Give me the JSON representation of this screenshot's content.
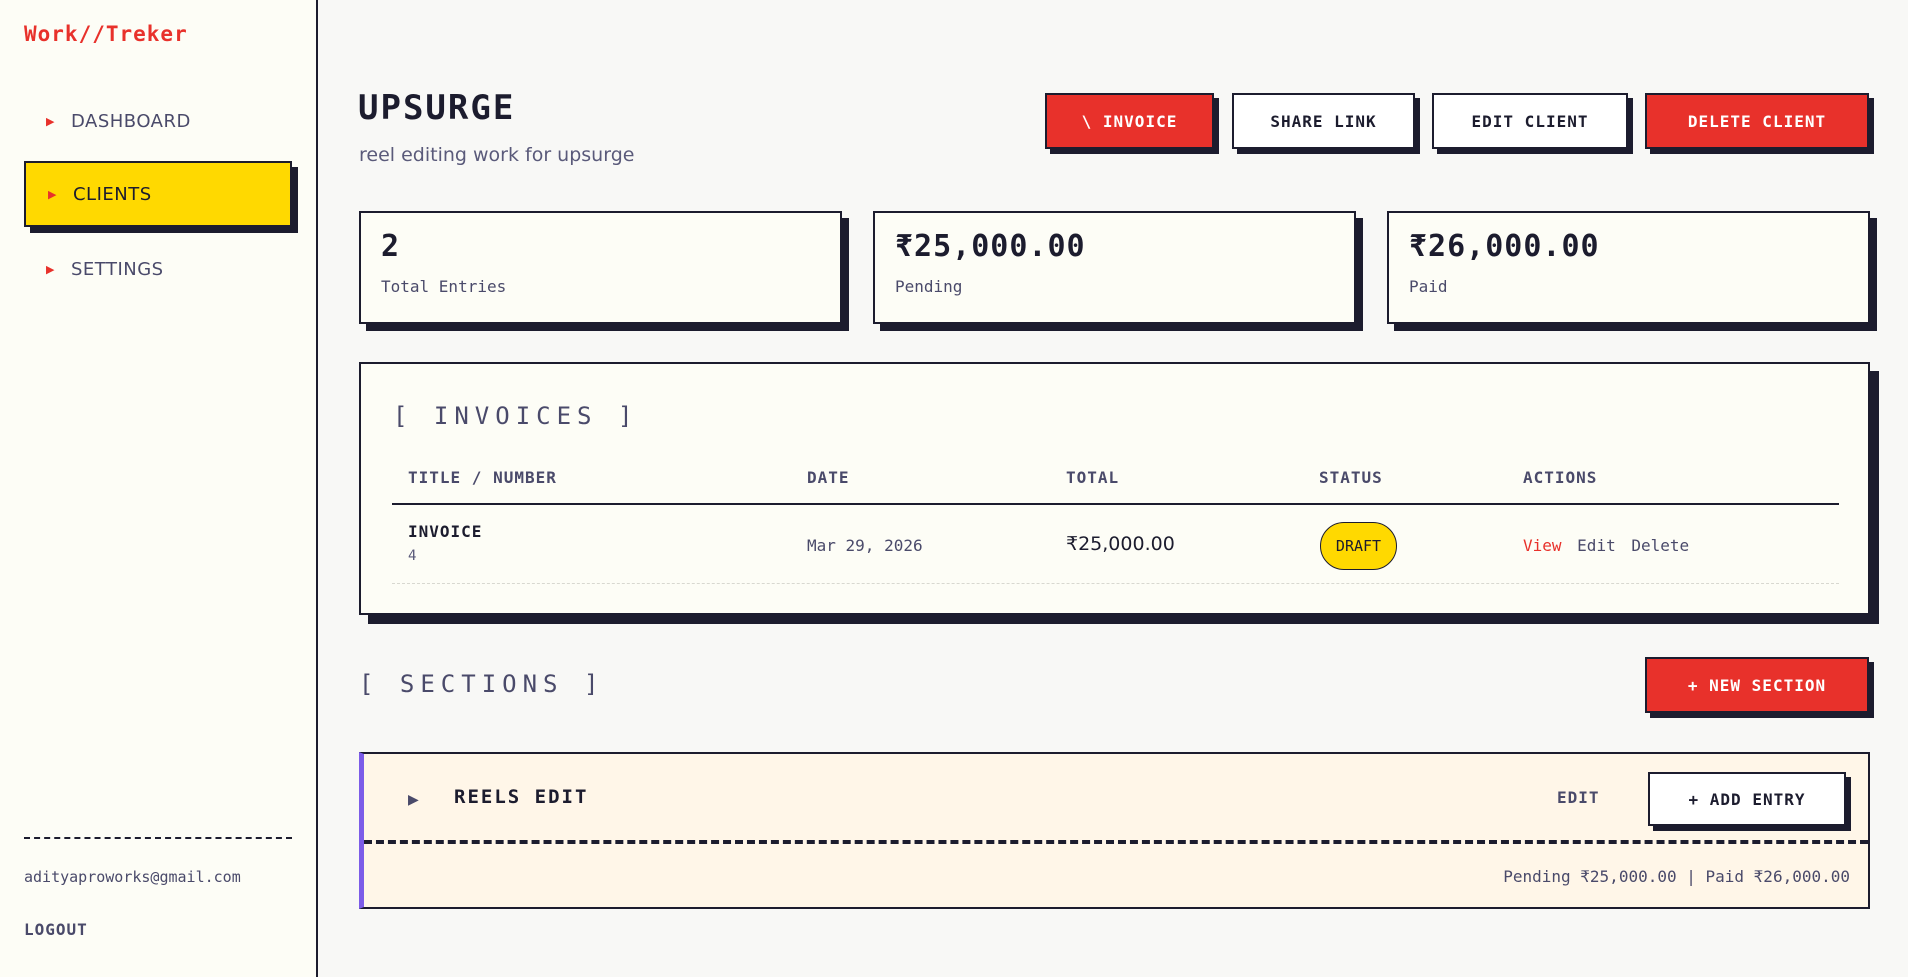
{
  "app": {
    "logo": "Work//Treker"
  },
  "sidebar": {
    "items": [
      {
        "label": "DASHBOARD",
        "active": false
      },
      {
        "label": "CLIENTS",
        "active": true
      },
      {
        "label": "SETTINGS",
        "active": false
      }
    ],
    "email": "adityaproworks@gmail.com",
    "logout": "LOGOUT"
  },
  "header": {
    "title": "UPSURGE",
    "subtitle": "reel editing work for upsurge",
    "buttons": {
      "invoice": "\\ INVOICE",
      "share": "SHARE LINK",
      "edit": "EDIT CLIENT",
      "delete": "DELETE CLIENT"
    }
  },
  "stats": [
    {
      "value": "2",
      "label": "Total Entries"
    },
    {
      "value": "₹25,000.00",
      "label": "Pending"
    },
    {
      "value": "₹26,000.00",
      "label": "Paid"
    }
  ],
  "invoices": {
    "title": "[ INVOICES ]",
    "columns": [
      "TITLE / NUMBER",
      "DATE",
      "TOTAL",
      "STATUS",
      "ACTIONS"
    ],
    "rows": [
      {
        "title": "INVOICE",
        "number": "4",
        "date": "Mar 29, 2026",
        "total": "₹25,000.00",
        "status": "DRAFT",
        "actions": {
          "view": "View",
          "edit": "Edit",
          "delete": "Delete"
        }
      }
    ]
  },
  "sections": {
    "title": "[ SECTIONS ]",
    "new_button": "+ NEW SECTION",
    "items": [
      {
        "name": "REELS EDIT",
        "expand_glyph": "▶",
        "edit": "EDIT",
        "add_entry": "+ ADD ENTRY",
        "summary": "Pending ₹25,000.00 | Paid ₹26,000.00"
      }
    ]
  },
  "colors": {
    "accent_red": "#e8312b",
    "accent_yellow": "#ffd900",
    "section_border": "#7c5ce8",
    "ink": "#1c1c2e"
  }
}
